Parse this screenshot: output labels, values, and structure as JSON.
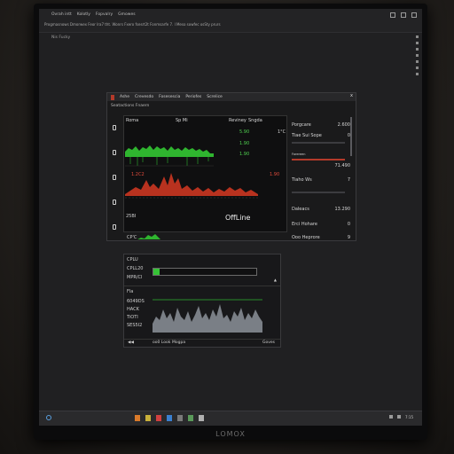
{
  "screen": {
    "menu": [
      "Ovrah intt",
      "Kolotly",
      "Fopvalry",
      "Gmowes"
    ],
    "toolbar": "Progmasnows  Dmorwex  Feor  Ira7 tht.  Wonrs  Fxero fsesrt2t  Fonmsarfe  7.  l Meso sowfec osSty prurs",
    "hint": "Nis Fucky"
  },
  "dashboard": {
    "tabs": [
      "Ashe",
      "Crevesdo",
      "Fosesescia",
      "Periofes",
      "Screlice"
    ],
    "close": "x",
    "subtitle": "Seatactions Fnaern",
    "headers": {
      "c1": "Roma",
      "c2": "Sp Mi",
      "c3": "Reviney",
      "c4": "Sngda"
    },
    "green_vals": [
      "5.90",
      "1.90",
      "1.90"
    ],
    "unit": "1°C",
    "red_label": "1.2C2",
    "red_val": "1.90",
    "ax_label": "25BI",
    "offline": "OffLine",
    "small_label": "CP'C",
    "right": [
      {
        "label": "Porgcare",
        "value": "2.600"
      },
      {
        "label": "Tiae Sui Sope",
        "value": "0"
      },
      {
        "label": "Forereen",
        "value": ""
      },
      {
        "label": "",
        "value": "71.490"
      },
      {
        "label": "Tiaho Ws",
        "value": "7"
      },
      {
        "label": "Daleacs",
        "value": "13.290"
      },
      {
        "label": "Erci Hohare",
        "value": "0"
      },
      {
        "label": "Ooo Heprore",
        "value": "9"
      }
    ]
  },
  "cpu_window": {
    "labels": [
      "CPLU",
      "CPLL20",
      "MPR/CI"
    ],
    "usage_fraction": 0.06,
    "caret": "▲",
    "list": [
      "Fla",
      "6049DS",
      "HACK",
      "TiOTI",
      "SES5I2"
    ],
    "footer": [
      "◀◀",
      "oo0 Look",
      "Mogpa",
      "Goves"
    ]
  },
  "taskbar": {
    "clock": "7:15"
  },
  "monitor_brand": "LOMOX",
  "colors": {
    "green": "#3cc93c",
    "red": "#d1412f",
    "accent": "#b43a2a"
  }
}
